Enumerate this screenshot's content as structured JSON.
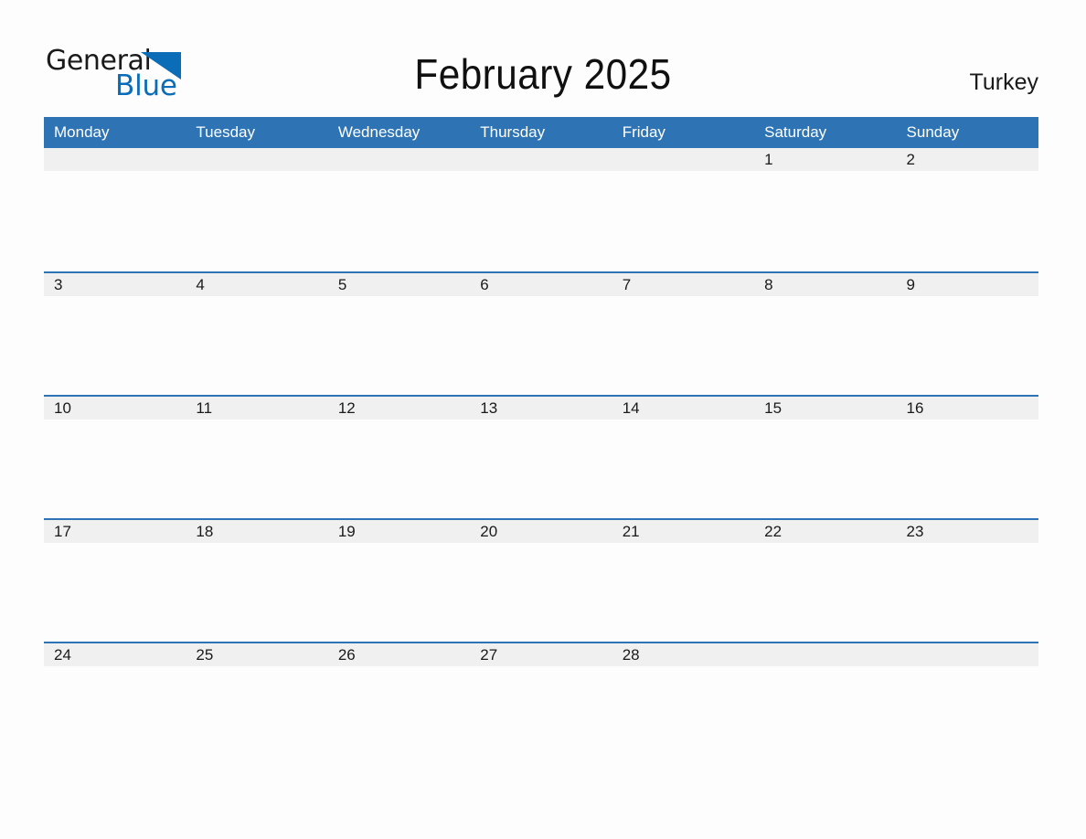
{
  "logo": {
    "text_primary": "General",
    "text_secondary": "Blue",
    "triangle_color": "#0b6db7",
    "primary_color": "#1a1a1a",
    "secondary_color": "#0b6db7"
  },
  "header": {
    "title": "February 2025",
    "country": "Turkey"
  },
  "colors": {
    "header_blue": "#2e74b5",
    "date_band_gray": "#f0f0f0",
    "page_background": "#fdfdfd",
    "text": "#1a1a1a"
  },
  "calendar": {
    "month": "February",
    "year": "2025",
    "weekday_headers": [
      "Monday",
      "Tuesday",
      "Wednesday",
      "Thursday",
      "Friday",
      "Saturday",
      "Sunday"
    ],
    "weeks": [
      {
        "days": [
          "",
          "",
          "",
          "",
          "",
          "1",
          "2"
        ]
      },
      {
        "days": [
          "3",
          "4",
          "5",
          "6",
          "7",
          "8",
          "9"
        ]
      },
      {
        "days": [
          "10",
          "11",
          "12",
          "13",
          "14",
          "15",
          "16"
        ]
      },
      {
        "days": [
          "17",
          "18",
          "19",
          "20",
          "21",
          "22",
          "23"
        ]
      },
      {
        "days": [
          "24",
          "25",
          "26",
          "27",
          "28",
          "",
          ""
        ]
      }
    ]
  }
}
